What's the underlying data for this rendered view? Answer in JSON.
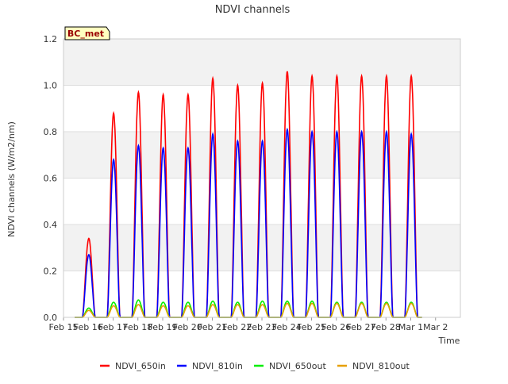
{
  "chart_data": {
    "type": "line",
    "title": "NDVI channels",
    "ylabel": "NDVI channels (W/m2/nm)",
    "xlabel": "Time",
    "site_badge": "BC_met",
    "ylim": [
      0,
      1.2
    ],
    "xlim": [
      0,
      16
    ],
    "y_ticks": [
      "0.0",
      "0.2",
      "0.4",
      "0.6",
      "0.8",
      "1.0",
      "1.2"
    ],
    "x_ticks": [
      "Feb 15",
      "Feb 16",
      "Feb 17",
      "Feb 18",
      "Feb 19",
      "Feb 20",
      "Feb 21",
      "Feb 22",
      "Feb 23",
      "Feb 24",
      "Feb 25",
      "Feb 26",
      "Feb 27",
      "Feb 28",
      "Mar 1",
      "Mar 2"
    ],
    "x_note": "x values are days since Feb 15; daily peak at ~midday",
    "daily_peaks_day_offsets": [
      0.0,
      1.0,
      2.0,
      3.0,
      4.0,
      5.0,
      6.0,
      7.0,
      8.0,
      9.0,
      10.0,
      11.0,
      12.0,
      13.0,
      14.0
    ],
    "series": [
      {
        "name": "NDVI_650in",
        "color": "#ff0000",
        "daily_peak_values": [
          0.34,
          0.88,
          0.97,
          0.96,
          0.96,
          1.03,
          1.0,
          1.01,
          1.06,
          1.04,
          1.04,
          1.04,
          1.04,
          1.04
        ]
      },
      {
        "name": "NDVI_810in",
        "color": "#0000ff",
        "daily_peak_values": [
          0.27,
          0.68,
          0.74,
          0.73,
          0.73,
          0.79,
          0.76,
          0.76,
          0.81,
          0.8,
          0.8,
          0.8,
          0.8,
          0.79
        ]
      },
      {
        "name": "NDVI_650out",
        "color": "#00ee00",
        "daily_peak_values": [
          0.04,
          0.065,
          0.075,
          0.065,
          0.065,
          0.07,
          0.065,
          0.07,
          0.07,
          0.07,
          0.065,
          0.065,
          0.065,
          0.065
        ]
      },
      {
        "name": "NDVI_810out",
        "color": "#e69f00",
        "daily_peak_values": [
          0.03,
          0.05,
          0.055,
          0.05,
          0.05,
          0.055,
          0.055,
          0.055,
          0.06,
          0.06,
          0.06,
          0.06,
          0.06,
          0.06
        ]
      }
    ],
    "grid": "horizontal bands",
    "legend_position": "bottom"
  }
}
